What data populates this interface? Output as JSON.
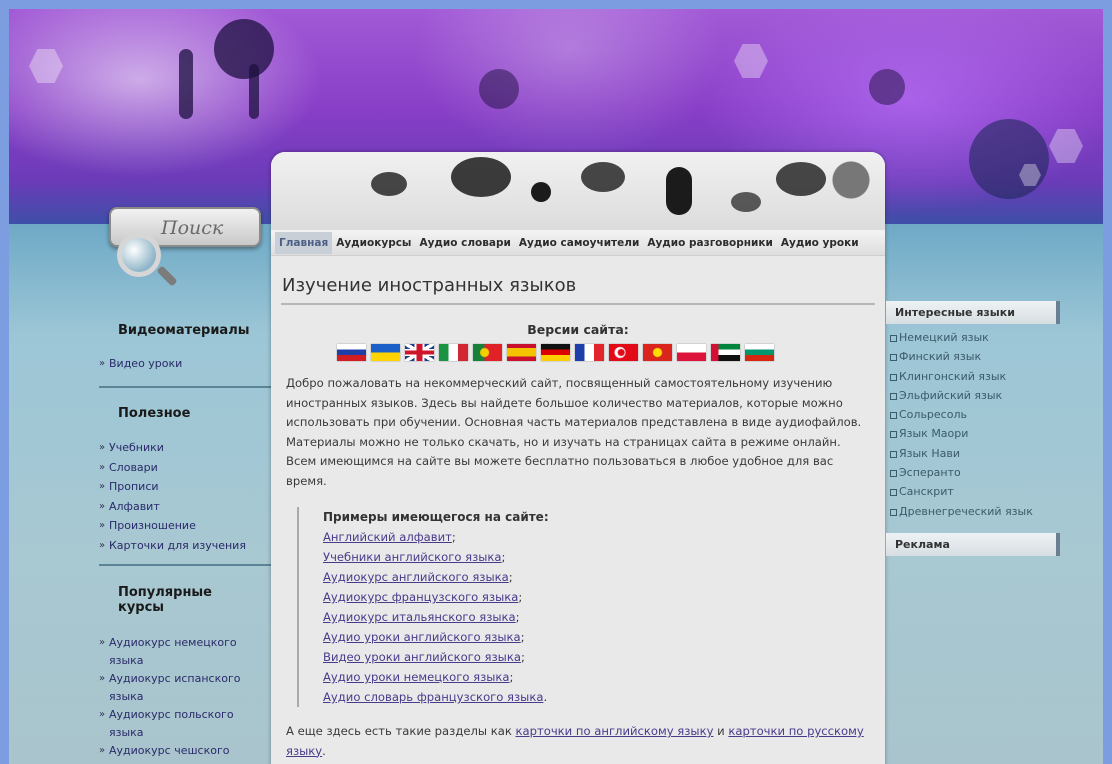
{
  "search": {
    "label": "Поиск"
  },
  "left": {
    "video_title": "Видеоматериалы",
    "video_items": [
      "Видео уроки"
    ],
    "useful_title": "Полезное",
    "useful_items": [
      "Учебники",
      "Словари",
      "Прописи",
      "Алфавит",
      "Произношение",
      "Карточки для изучения"
    ],
    "popular_title": "Популярные курсы",
    "popular_items": [
      "Аудиокурс немецкого языка",
      "Аудиокурс испанского языка",
      "Аудиокурс польского языка",
      "Аудиокурс чешского языка"
    ]
  },
  "nav": {
    "items": [
      "Главная",
      "Аудиокурсы",
      "Аудио словари",
      "Аудио самоучители",
      "Аудио разговорники",
      "Аудио уроки"
    ]
  },
  "main": {
    "title": "Изучение иностранных языков",
    "versions_label": "Версии сайта:",
    "flags": [
      "russia-flag",
      "ukraine-flag",
      "uk-flag",
      "italy-flag",
      "portugal-flag",
      "spain-flag",
      "germany-flag",
      "france-flag",
      "turkey-flag",
      "vietnam-flag",
      "poland-flag",
      "uae-flag",
      "bulgaria-flag"
    ],
    "intro": "Добро пожаловать на некоммерческий сайт, посвященный самостоятельному изучению иностранных языков. Здесь вы найдете большое количество материалов, которые можно использовать при обучении. Основная часть материалов представлена в виде аудиофайлов. Материалы можно не только скачать, но и изучать на страницах сайта в режиме онлайн. Всем имеющимся на сайте вы можете бесплатно пользоваться в любое удобное для вас время.",
    "examples_title": "Примеры имеющегося на сайте:",
    "examples": [
      "Английский алфавит",
      "Учебники английского языка",
      "Аудиокурс английского языка",
      "Аудиокурс французского языка",
      "Аудиокурс итальянского языка",
      "Аудио уроки английского языка",
      "Видео уроки английского языка",
      "Аудио уроки немецкого языка",
      "Аудио словарь французского языка"
    ],
    "outro_prefix": "А еще здесь есть такие разделы как ",
    "outro_link1": "карточки по английскому языку",
    "outro_middle": " и ",
    "outro_link2": "карточки по русскому языку",
    "outro_suffix": "."
  },
  "right": {
    "interesting_title": "Интересные языки",
    "interesting_items": [
      "Немецкий язык",
      "Финский язык",
      "Клингонский язык",
      "Эльфийский язык",
      "Сольресоль",
      "Язык Маори",
      "Язык Нави",
      "Эсперанто",
      "Санскрит",
      "Древнегреческий язык"
    ],
    "ads_title": "Реклама"
  }
}
